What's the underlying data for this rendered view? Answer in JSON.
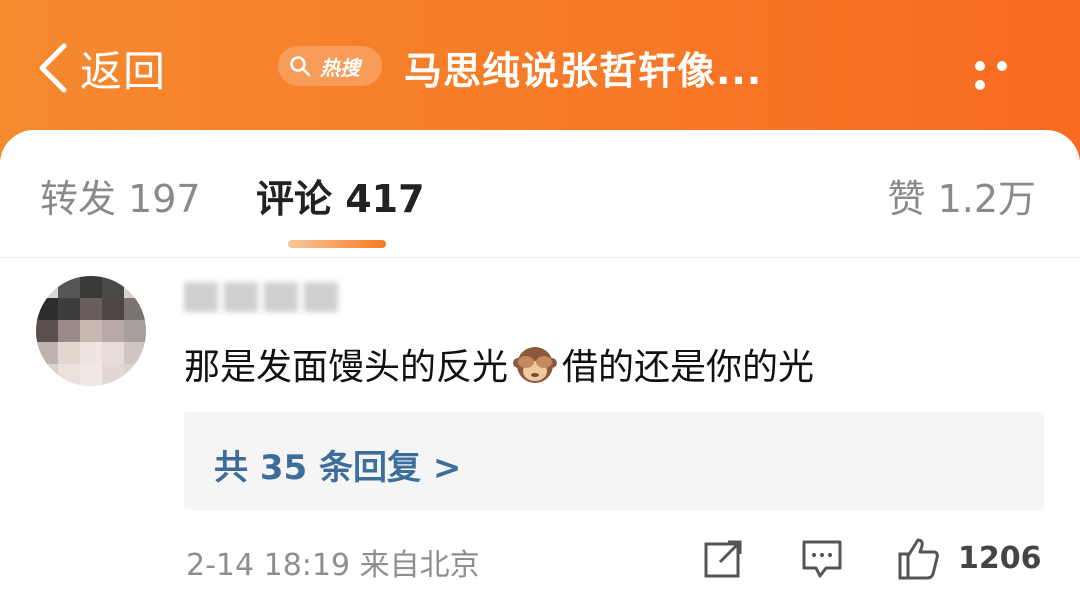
{
  "header": {
    "back_label": "返回",
    "hot_badge": "热搜",
    "hot_title": "马思纯说张哲轩像...",
    "more_icon": "more-dots-icon"
  },
  "tabs": {
    "repost": "转发 197",
    "comment": "评论 417",
    "like": "赞 1.2万"
  },
  "comment": {
    "text_before": "那是发面馒头的反光",
    "emoji": "see-no-evil-monkey",
    "text_after": "借的还是你的光",
    "replies": "共 35 条回复 >",
    "meta": "2-14 18:19 来自北京",
    "like_count": "1206"
  },
  "colors": {
    "header_start": "#f58a2f",
    "header_end": "#f86a22",
    "link": "#3d6d9a"
  }
}
